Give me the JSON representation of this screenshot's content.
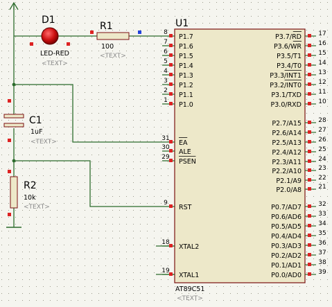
{
  "colors": {
    "background": "#f5f5ef",
    "wire": "#2b6b2b",
    "chip_fill": "#ede8c9",
    "chip_border": "#7a1010",
    "led": "#cc1111",
    "resistor_fill": "#ede8c9",
    "pin_marker_red": "#dd2222",
    "pin_marker_blue": "#2244dd"
  },
  "components": {
    "led": {
      "ref": "D1",
      "value": "LED-RED",
      "text": "<TEXT>"
    },
    "r1": {
      "ref": "R1",
      "value": "100",
      "text": "<TEXT>"
    },
    "c1": {
      "ref": "C1",
      "value": "1uF",
      "text": "<TEXT>"
    },
    "r2": {
      "ref": "R2",
      "value": "10k",
      "text": "<TEXT>"
    },
    "mcu": {
      "ref": "U1",
      "part": "AT89C51",
      "text": "<TEXT>"
    }
  },
  "left_pins": [
    {
      "num": "8",
      "label": "P1.7"
    },
    {
      "num": "7",
      "label": "P1.6"
    },
    {
      "num": "6",
      "label": "P1.5"
    },
    {
      "num": "5",
      "label": "P1.4"
    },
    {
      "num": "4",
      "label": "P1.3"
    },
    {
      "num": "3",
      "label": "P1.2"
    },
    {
      "num": "2",
      "label": "P1.1"
    },
    {
      "num": "1",
      "label": "P1.0"
    },
    {
      "num": "31",
      "label": "EA"
    },
    {
      "num": "30",
      "label": "ALE"
    },
    {
      "num": "29",
      "label": "PSEN"
    },
    {
      "num": "9",
      "label": "RST"
    },
    {
      "num": "18",
      "label": "XTAL2"
    },
    {
      "num": "19",
      "label": "XTAL1"
    }
  ],
  "right_pins": [
    {
      "num": "17",
      "label": "P3.7/RD"
    },
    {
      "num": "16",
      "label": "P3.6/WR"
    },
    {
      "num": "15",
      "label": "P3.5/T1"
    },
    {
      "num": "14",
      "label": "P3.4/T0"
    },
    {
      "num": "13",
      "label": "P3.3/INT1"
    },
    {
      "num": "12",
      "label": "P3.2/INT0"
    },
    {
      "num": "11",
      "label": "P3.1/TXD"
    },
    {
      "num": "10",
      "label": "P3.0/RXD"
    },
    {
      "num": "28",
      "label": "P2.7/A15"
    },
    {
      "num": "27",
      "label": "P2.6/A14"
    },
    {
      "num": "26",
      "label": "P2.5/A13"
    },
    {
      "num": "25",
      "label": "P2.4/A12"
    },
    {
      "num": "24",
      "label": "P2.3/A11"
    },
    {
      "num": "23",
      "label": "P2.2/A10"
    },
    {
      "num": "22",
      "label": "P2.1/A9"
    },
    {
      "num": "21",
      "label": "P2.0/A8"
    },
    {
      "num": "32",
      "label": "P0.7/AD7"
    },
    {
      "num": "33",
      "label": "P0.6/AD6"
    },
    {
      "num": "34",
      "label": "P0.5/AD5"
    },
    {
      "num": "35",
      "label": "P0.4/AD4"
    },
    {
      "num": "36",
      "label": "P0.3/AD3"
    },
    {
      "num": "37",
      "label": "P0.2/AD2"
    },
    {
      "num": "38",
      "label": "P0.1/AD1"
    },
    {
      "num": "39",
      "label": "P0.0/AD0"
    }
  ]
}
